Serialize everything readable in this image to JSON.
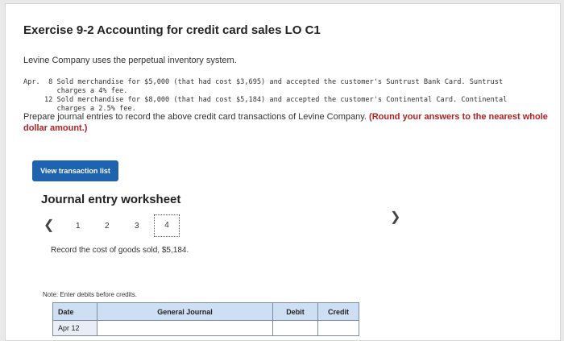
{
  "page": {
    "title": "Exercise 9-2 Accounting for credit card sales LO C1",
    "intro": "Levine Company uses the perpetual inventory system.",
    "transactions": {
      "month": "Apr.",
      "t1_line1": " 8 Sold merchandise for $5,000 (that had cost $3,695) and accepted the customer's Suntrust Bank Card. Suntrust",
      "t1_line2": "   charges a 4% fee.",
      "t2_line1": "12 Sold merchandise for $8,000 (that had cost $5,184) and accepted the customer's Continental Card. Continental",
      "t2_line2": "   charges a 2.5% fee."
    },
    "instructions_plain": "Prepare journal entries to record the above credit card transactions of Levine Company.",
    "instructions_bold": "(Round your answers to the nearest whole dollar amount.)",
    "view_button": "View transaction list"
  },
  "worksheet": {
    "title": "Journal entry worksheet",
    "pages": [
      "1",
      "2",
      "3",
      "4"
    ],
    "active_page": "4",
    "record_text": "Record the cost of goods sold, $5,184.",
    "note": "Note: Enter debits before credits."
  },
  "table": {
    "headers": {
      "date": "Date",
      "account": "General Journal",
      "debit": "Debit",
      "credit": "Credit"
    },
    "rows": [
      {
        "date": "Apr 12",
        "account": "",
        "debit": "",
        "credit": ""
      }
    ]
  },
  "colors": {
    "button": "#1e63b0",
    "table_header": "#cfdff3",
    "instruction_highlight": "#b22222"
  }
}
